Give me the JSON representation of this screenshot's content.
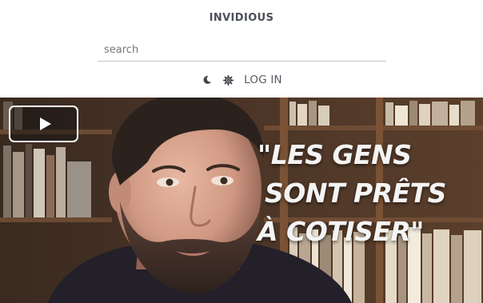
{
  "header": {
    "brand": "INVIDIOUS"
  },
  "search": {
    "placeholder": "search",
    "value": ""
  },
  "user_bar": {
    "theme_icon": "moon-icon",
    "preferences_icon": "gear-icon",
    "login_label": "LOG IN"
  },
  "video": {
    "play_icon": "play-icon",
    "caption_lines": [
      "\"LES GENS",
      "SONT PRÊTS",
      "À COTISER\""
    ]
  },
  "colors": {
    "brand_text": "#4a4f57",
    "caption_text": "#f4f4f4",
    "search_border": "#c7c7c7"
  }
}
